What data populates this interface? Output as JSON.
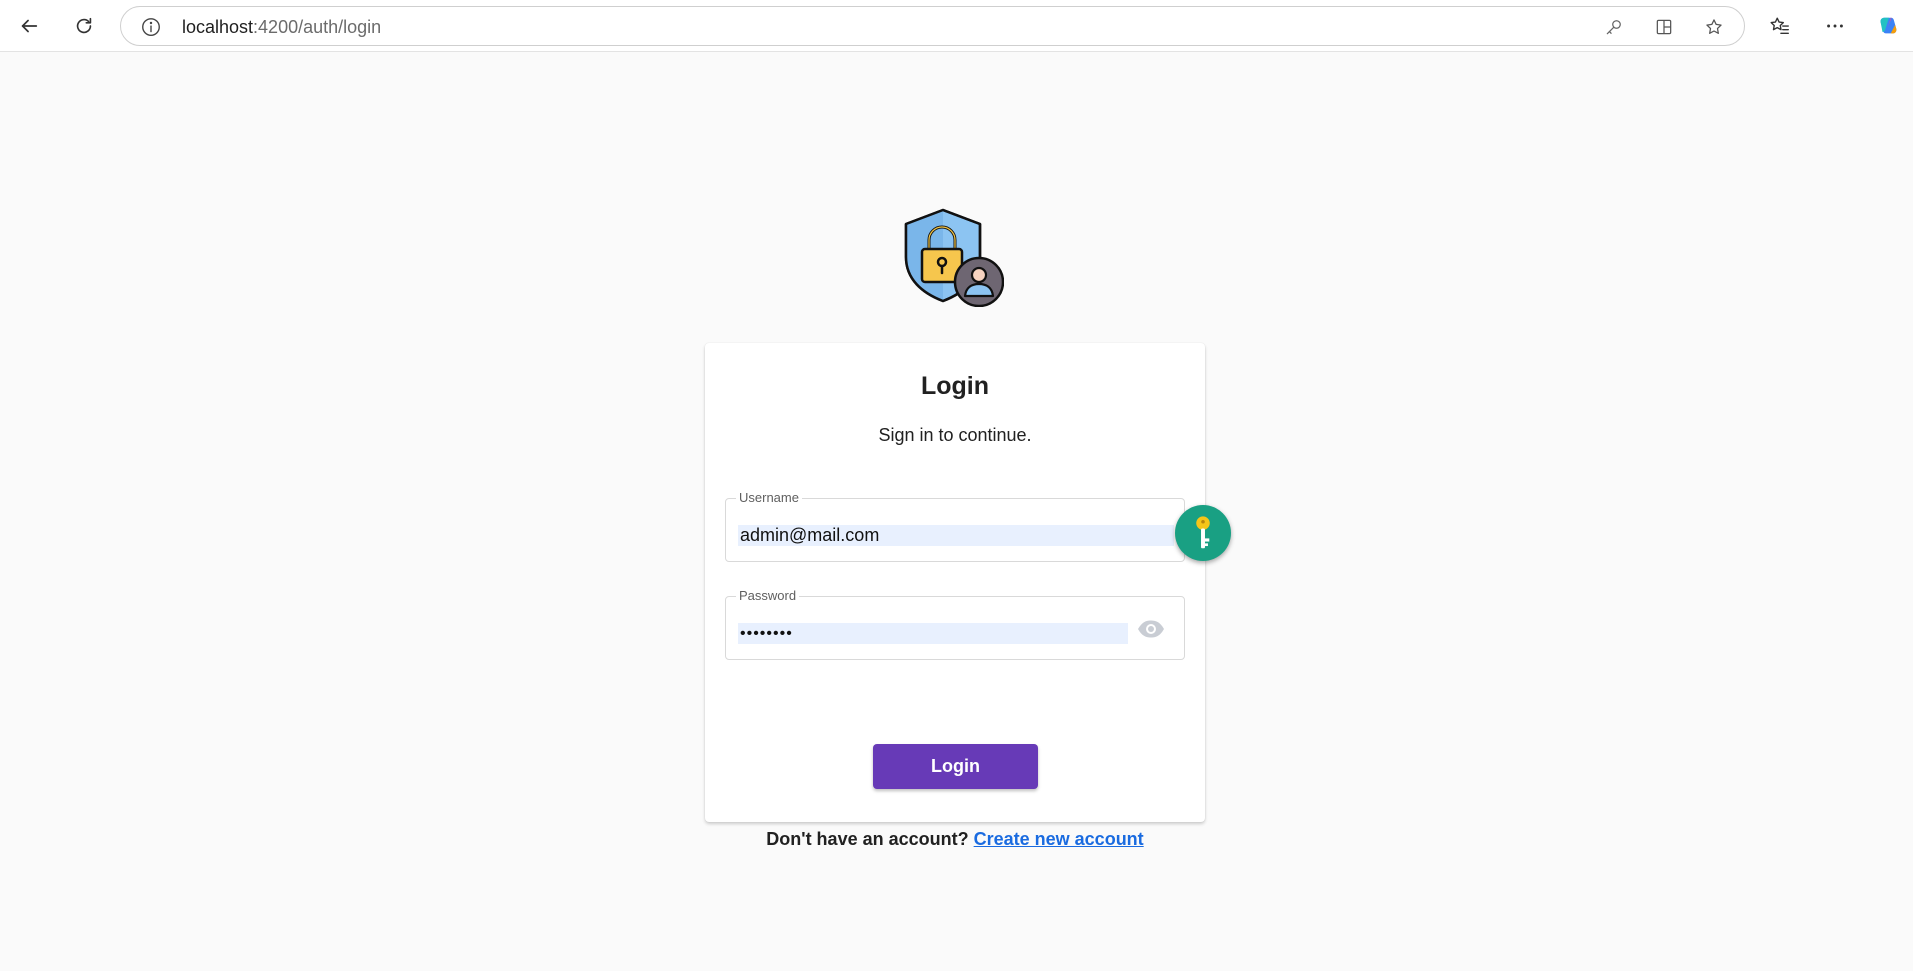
{
  "browser": {
    "url_host": "localhost",
    "url_rest": ":4200/auth/login"
  },
  "icons": {
    "back": "arrow-left-icon",
    "reload": "reload-icon",
    "info": "info-icon",
    "password_key": "key-icon",
    "split_tab": "split-screen-icon",
    "favorite": "star-icon",
    "favorites_list": "favorites-icon",
    "more": "more-icon",
    "copilot": "copilot-icon",
    "logo": "shield-lock-user-icon",
    "show_password": "eye-icon",
    "password_manager": "key-badge-icon"
  },
  "login": {
    "title": "Login",
    "subtitle": "Sign in to continue.",
    "username_label": "Username",
    "username_value": "admin@mail.com",
    "password_label": "Password",
    "password_value": "••••••••",
    "submit_label": "Login",
    "signup_prompt": "Don't have an account?",
    "signup_link": "Create new account"
  },
  "colors": {
    "primary": "#673ab7",
    "link": "#1a6be0",
    "autofill_bg": "#e8f0fe",
    "badge": "#19a083"
  }
}
